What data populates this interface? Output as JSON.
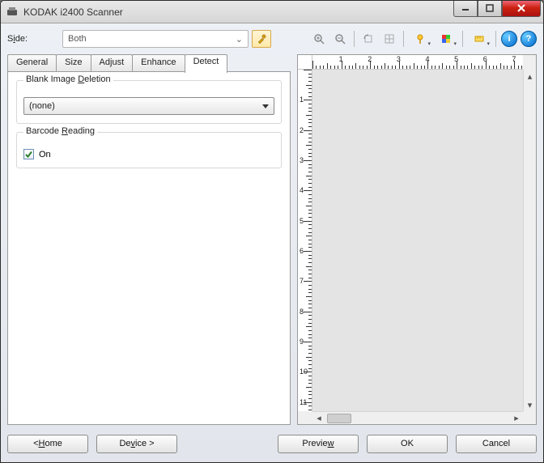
{
  "window": {
    "title": "KODAK i2400 Scanner"
  },
  "side": {
    "label_pre": "S",
    "label_ul": "i",
    "label_post": "de:",
    "value": "Both"
  },
  "tabs": [
    {
      "id": "general",
      "label": "General"
    },
    {
      "id": "size",
      "label": "Size"
    },
    {
      "id": "adjust",
      "label": "Adjust"
    },
    {
      "id": "enhance",
      "label": "Enhance"
    },
    {
      "id": "detect",
      "label": "Detect"
    }
  ],
  "active_tab": "detect",
  "detect": {
    "blank_group_pre": "Blank Image ",
    "blank_group_ul": "D",
    "blank_group_post": "eletion",
    "blank_value": "(none)",
    "barcode_group_pre": "Barcode ",
    "barcode_group_ul": "R",
    "barcode_group_post": "eading",
    "barcode_on_label": "On",
    "barcode_on_checked": true
  },
  "ruler": {
    "h_labels": [
      "1",
      "2",
      "3",
      "4",
      "5",
      "6",
      "7"
    ],
    "v_labels": [
      "1",
      "2",
      "3",
      "4",
      "5",
      "6",
      "7",
      "8",
      "9",
      "10",
      "11"
    ]
  },
  "buttons": {
    "home_pre": "< ",
    "home_ul": "H",
    "home_post": "ome",
    "device_pre": "De",
    "device_ul": "v",
    "device_post": "ice >",
    "preview_pre": "Previe",
    "preview_ul": "w",
    "preview_post": "",
    "ok": "OK",
    "cancel": "Cancel"
  }
}
